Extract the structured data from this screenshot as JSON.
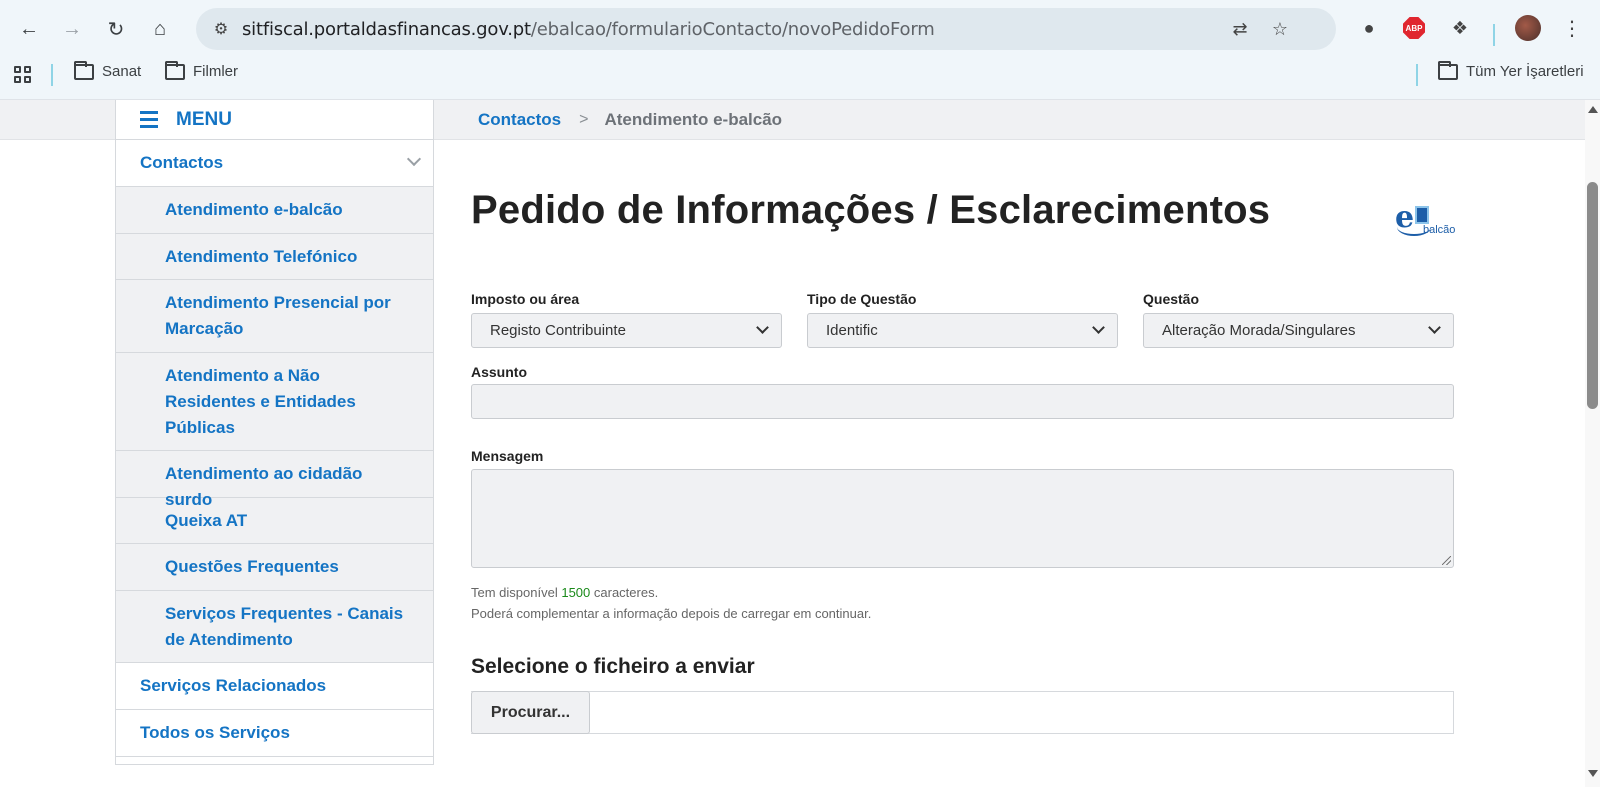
{
  "browser": {
    "url_host": "sitfiscal.portaldasfinancas.gov.pt",
    "url_path": "/ebalcao/formularioContacto/novoPedidoForm",
    "extension_abp_label": "ABP",
    "bookmarks": [
      {
        "label": "Sanat"
      },
      {
        "label": "Filmler"
      }
    ],
    "all_bookmarks_label": "Tüm Yer İşaretleri"
  },
  "sidebar": {
    "menu_label": "MENU",
    "top_item": "Contactos",
    "sub_items": [
      {
        "label": "Atendimento e-balcão"
      },
      {
        "label": "Atendimento Telefónico"
      },
      {
        "label": "Atendimento Presencial por Marcação"
      },
      {
        "label": "Atendimento a Não Residentes e Entidades Públicas"
      },
      {
        "label": "Atendimento ao cidadão surdo"
      },
      {
        "label": "Queixa AT"
      },
      {
        "label": "Questões Frequentes"
      },
      {
        "label": "Serviços Frequentes - Canais de Atendimento"
      }
    ],
    "bottom_items": [
      {
        "label": "Serviços Relacionados"
      },
      {
        "label": "Todos os Serviços"
      }
    ]
  },
  "breadcrumb": {
    "parent": "Contactos",
    "separator": ">",
    "current": "Atendimento e-balcão"
  },
  "page": {
    "title": "Pedido de Informações / Esclarecimentos",
    "logo_text": "balcão",
    "logo_letter": "e"
  },
  "form": {
    "imposto_label": "Imposto ou área",
    "imposto_value": "Registo Contribuinte",
    "tipo_label": "Tipo de Questão",
    "tipo_value": "Identific",
    "questao_label": "Questão",
    "questao_value": "Alteração Morada/Singulares",
    "assunto_label": "Assunto",
    "assunto_value": "",
    "mensagem_label": "Mensagem",
    "mensagem_value": "",
    "chars_prefix": "Tem disponível",
    "chars_count": "1500",
    "chars_suffix": "caracteres.",
    "hint2": "Poderá complementar a informação depois de carregar em continuar.",
    "file_heading": "Selecione o ficheiro a enviar",
    "file_button": "Procurar..."
  },
  "colors": {
    "link_blue": "#1474c4",
    "counter_green": "#1a8a1a",
    "sub_bg": "#f0f1f3"
  }
}
